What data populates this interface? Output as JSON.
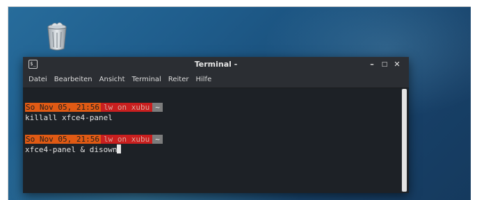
{
  "desktop": {
    "icons": [
      {
        "name": "trash-icon"
      }
    ]
  },
  "window": {
    "title": "Terminal -",
    "icon_glyph": "$_",
    "controls": {
      "minimize": "–",
      "maximize": "□",
      "close": "✕"
    },
    "menu": [
      {
        "label": "Datei"
      },
      {
        "label": "Bearbeiten"
      },
      {
        "label": "Ansicht"
      },
      {
        "label": "Terminal"
      },
      {
        "label": "Reiter"
      },
      {
        "label": "Hilfe"
      }
    ]
  },
  "terminal": {
    "entries": [
      {
        "date": "So Nov 05, 21:56",
        "user_host": "lw on xubu",
        "dir": "~",
        "command": "killall xfce4-panel"
      },
      {
        "date": "So Nov 05, 21:56",
        "user_host": "lw on xubu",
        "dir": "~",
        "command": "xfce4-panel & disown"
      }
    ]
  },
  "colors": {
    "prompt_date_bg": "#e05a14",
    "prompt_user_bg": "#c91f1f",
    "prompt_dir_bg": "#7c7c7c",
    "terminal_bg": "#1d2126",
    "titlebar_bg": "#2b2e33"
  }
}
